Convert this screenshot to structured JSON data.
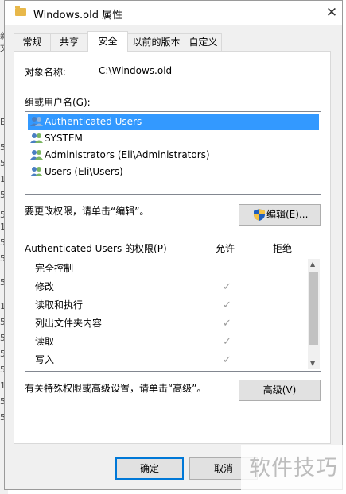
{
  "window": {
    "title": "Windows.old 属性"
  },
  "tabs": [
    {
      "label": "常规"
    },
    {
      "label": "共享"
    },
    {
      "label": "安全"
    },
    {
      "label": "以前的版本"
    },
    {
      "label": "自定义"
    }
  ],
  "security": {
    "object_name_label": "对象名称:",
    "object_name_value": "C:\\Windows.old",
    "groups_label": "组或用户名(G):",
    "users": [
      {
        "name": "Authenticated Users",
        "selected": true
      },
      {
        "name": "SYSTEM",
        "selected": false
      },
      {
        "name": "Administrators (Eli\\Administrators)",
        "selected": false
      },
      {
        "name": "Users (Eli\\Users)",
        "selected": false
      }
    ],
    "change_hint": "要更改权限，请单击“编辑”。",
    "edit_button": "编辑(E)...",
    "permissions_label": "Authenticated Users 的权限(P)",
    "allow_header": "允许",
    "deny_header": "拒绝",
    "permissions": [
      {
        "name": "完全控制",
        "allow": false
      },
      {
        "name": "修改",
        "allow": true
      },
      {
        "name": "读取和执行",
        "allow": true
      },
      {
        "name": "列出文件夹内容",
        "allow": true
      },
      {
        "name": "读取",
        "allow": true
      },
      {
        "name": "写入",
        "allow": true
      }
    ],
    "check_glyph": "✓",
    "advanced_hint": "有关特殊权限或高级设置，请单击“高级”。",
    "advanced_button": "高级(V)"
  },
  "footer": {
    "ok_button": "确定",
    "cancel_button": "取消"
  },
  "background_fragments": [
    "新",
    "文",
    "E",
    "5",
    "5",
    "1",
    "5",
    "5",
    "1",
    "5",
    "5",
    "5",
    "1",
    "5",
    "5",
    "5",
    "5",
    "1",
    "5",
    "5"
  ],
  "watermark": "软件技巧",
  "colors": {
    "selection": "#3399ff",
    "panel": "#ffffff",
    "dialog": "#f0f0f0",
    "default_button_border": "#0078d7"
  }
}
